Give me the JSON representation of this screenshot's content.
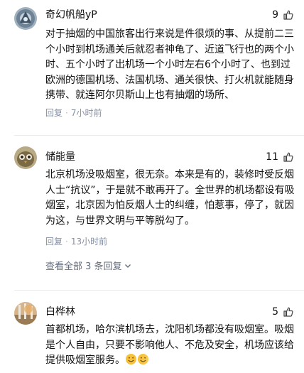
{
  "comments": [
    {
      "author": "奇幻帆船yP",
      "likes": "9",
      "text": "对于抽烟的中国旅客出行来说是件很烦的事、从提前二三个小时到机场通关后就忍者神龟了、近道飞行也的两个小时、五个小时了出机场一个小时左右6个小时了、也到过欧洲的德国机场、法国机场、通关很快、打火机就能随身携带、就连阿尔贝斯山上也有抽烟的场所、",
      "reply_label": "回复",
      "time": "7小时前"
    },
    {
      "author": "储能量",
      "likes": "11",
      "text": "北京机场没吸烟室，很无奈。本来是有的，装修时受反烟人士“抗议”，于是就不敢再开了。全世界的机场都设有吸烟室，北京因为怕反烟人士的纠缠，怕惹事，停了，就因为这，与世界文明与平等脱勾了。",
      "reply_label": "回复",
      "time": "13小时前",
      "view_all": "查看全部 3 条回复"
    },
    {
      "author": "白桦林",
      "likes": "5",
      "text": "首都机场，哈尔滨机场去，沈阳机场都没有吸烟室。吸烟是个人自由，只要不影响他人、不危及安全，机场应该给提供吸烟室服务。"
    }
  ],
  "icons": {
    "like": "thumbs-up-icon",
    "expand": "chevron-down-icon",
    "emoji": "smiley-emoji-icon"
  },
  "colors": {
    "text": "#121212",
    "meta": "#8590a6",
    "divider": "#ebebeb"
  }
}
